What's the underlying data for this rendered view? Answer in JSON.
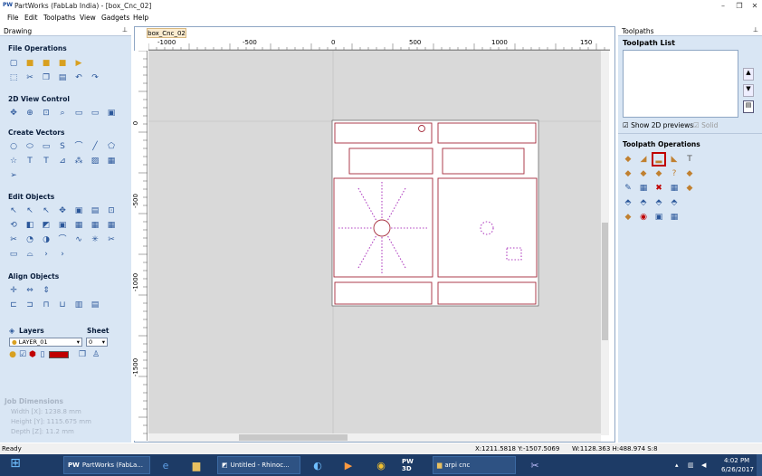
{
  "window": {
    "title": "PartWorks (FabLab India) - [box_Cnc_02]",
    "app_icon": "PW",
    "minimize": "–",
    "restore": "❐",
    "close": "✕"
  },
  "menu": [
    "File",
    "Edit",
    "Toolpaths",
    "View",
    "Gadgets",
    "Help"
  ],
  "left_panel": {
    "title": "Drawing",
    "pin": "⊥",
    "sections": [
      "File Operations",
      "2D View Control",
      "Create Vectors",
      "Edit Objects",
      "Align Objects"
    ],
    "layers_label": "Layers",
    "sheet_label": "Sheet",
    "layer_value": "LAYER_01",
    "sheet_value": "0",
    "job_title": "Job Dimensions",
    "job": [
      "Width  [X]: 1238.8 mm",
      "Height [Y]: 1115.675 mm",
      "Depth  [Z]: 11.2 mm"
    ]
  },
  "document": {
    "tab": "box_Cnc_02",
    "ruler_top": [
      "-1000",
      "-500",
      "0",
      "500",
      "1000",
      "150"
    ],
    "ruler_left": [
      "0",
      "-500",
      "-1000",
      "-1500"
    ]
  },
  "right_panel": {
    "title": "Toolpaths",
    "pin": "⊥",
    "list_title": "Toolpath List",
    "show_previews": "Show 2D previews",
    "solid": "Solid",
    "ops_title": "Toolpath Operations"
  },
  "status": {
    "left": "Ready",
    "coords": "X:1211.5818 Y:-1507.5069",
    "size": "W:1128.363  H:488.974  S:8"
  },
  "taskbar": {
    "apps": [
      {
        "label": "PartWorks (FabLa..."
      },
      {
        "label": "Untitled - Rhinoc..."
      },
      {
        "label": "arpi cnc"
      }
    ],
    "pw3d": "PW 3D",
    "time": "4:02 PM",
    "date": "6/26/2017"
  },
  "colors": {
    "cut_lines": "#a52a3a",
    "dotted": "#b040c0",
    "accent": "#c00000"
  }
}
